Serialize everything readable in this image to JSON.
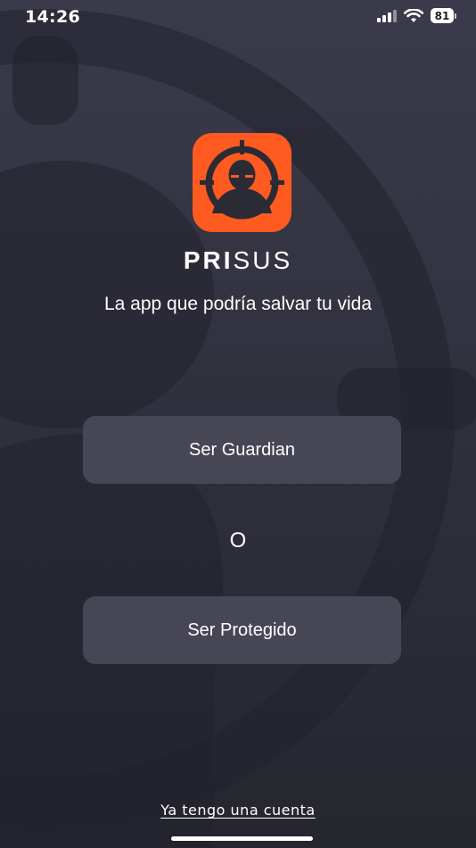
{
  "status_bar": {
    "time": "14:26",
    "battery": "81",
    "icons": [
      "cellular-signal-icon",
      "wifi-icon",
      "battery-icon"
    ]
  },
  "colors": {
    "background": "#2d2d3c",
    "accent": "#ff5a1f",
    "button": "#474655"
  },
  "app": {
    "logo_icon": "masked-person-target-icon",
    "brand_bold": "PRI",
    "brand_light": "SUS",
    "tagline": "La app que podría salvar tu vida"
  },
  "actions": {
    "guardian_label": "Ser Guardian",
    "or_label": "O",
    "protegido_label": "Ser Protegido",
    "login_link": "Ya tengo una cuenta"
  }
}
